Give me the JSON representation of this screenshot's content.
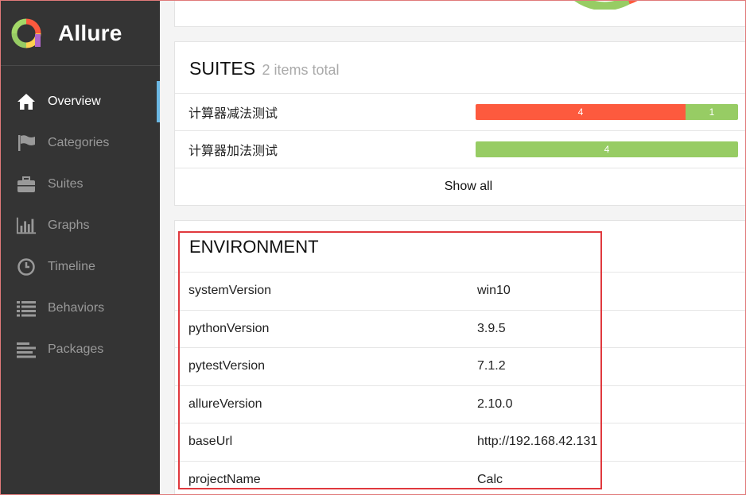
{
  "app": {
    "name": "Allure"
  },
  "sidebar": {
    "items": [
      {
        "label": "Overview",
        "icon": "home-icon",
        "active": true
      },
      {
        "label": "Categories",
        "icon": "flag-icon",
        "active": false
      },
      {
        "label": "Suites",
        "icon": "briefcase-icon",
        "active": false
      },
      {
        "label": "Graphs",
        "icon": "bar-chart-icon",
        "active": false
      },
      {
        "label": "Timeline",
        "icon": "clock-icon",
        "active": false
      },
      {
        "label": "Behaviors",
        "icon": "list-icon",
        "active": false
      },
      {
        "label": "Packages",
        "icon": "align-left-icon",
        "active": false
      }
    ]
  },
  "suites": {
    "title": "SUITES",
    "subtitle": "2 items total",
    "rows": [
      {
        "name": "计算器减法测试",
        "failed": 4,
        "passed": 1,
        "failed_label": "4",
        "passed_label": "1"
      },
      {
        "name": "计算器加法测试",
        "failed": 0,
        "passed": 4,
        "failed_label": "",
        "passed_label": "4"
      }
    ],
    "show_all": "Show all"
  },
  "environment": {
    "title": "ENVIRONMENT",
    "rows": [
      {
        "key": "systemVersion",
        "value": "win10"
      },
      {
        "key": "pythonVersion",
        "value": "3.9.5"
      },
      {
        "key": "pytestVersion",
        "value": "7.1.2"
      },
      {
        "key": "allureVersion",
        "value": "2.10.0"
      },
      {
        "key": "baseUrl",
        "value": "http://192.168.42.131"
      },
      {
        "key": "projectName",
        "value": "Calc"
      }
    ]
  },
  "colors": {
    "failed": "#fd5a3e",
    "passed": "#97cc64",
    "sidebar_bg": "#343434",
    "active_marker": "#6bb7e3",
    "highlight": "#e0393e"
  }
}
